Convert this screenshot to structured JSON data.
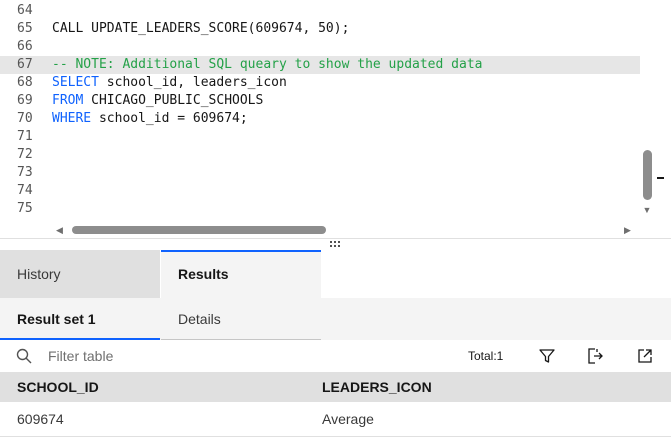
{
  "editor": {
    "lines": [
      {
        "num": "64",
        "parts": []
      },
      {
        "num": "65",
        "parts": [
          {
            "t": "CALL UPDATE_LEADERS_SCORE(609674, 50);",
            "c": ""
          }
        ]
      },
      {
        "num": "66",
        "parts": []
      },
      {
        "num": "67",
        "hl": true,
        "parts": [
          {
            "t": "-- NOTE: Additional SQL queary to show the updated data",
            "c": "cm"
          }
        ]
      },
      {
        "num": "68",
        "parts": [
          {
            "t": "SELECT",
            "c": "kw"
          },
          {
            "t": " school_id, leaders_icon",
            "c": ""
          }
        ]
      },
      {
        "num": "69",
        "parts": [
          {
            "t": "FROM",
            "c": "kw"
          },
          {
            "t": " CHICAGO_PUBLIC_SCHOOLS",
            "c": ""
          }
        ]
      },
      {
        "num": "70",
        "parts": [
          {
            "t": "WHERE",
            "c": "kw"
          },
          {
            "t": " school_id = 609674;",
            "c": ""
          }
        ]
      },
      {
        "num": "71",
        "parts": []
      },
      {
        "num": "72",
        "parts": []
      },
      {
        "num": "73",
        "parts": []
      },
      {
        "num": "74",
        "parts": []
      },
      {
        "num": "75",
        "parts": []
      }
    ]
  },
  "tabs": {
    "history": "History",
    "results": "Results"
  },
  "subtabs": {
    "result_set": "Result set 1",
    "details": "Details"
  },
  "toolbar": {
    "filter_placeholder": "Filter table",
    "total": "Total:1"
  },
  "table": {
    "columns": [
      "SCHOOL_ID",
      "LEADERS_ICON"
    ],
    "rows": [
      [
        "609674",
        "Average"
      ]
    ]
  },
  "icons": {
    "search": "search-icon",
    "filter": "filter-icon",
    "export": "export-icon",
    "launch": "launch-icon"
  },
  "colors": {
    "keyword": "#0f62fe",
    "comment": "#24a148",
    "accent": "#0f62fe"
  }
}
